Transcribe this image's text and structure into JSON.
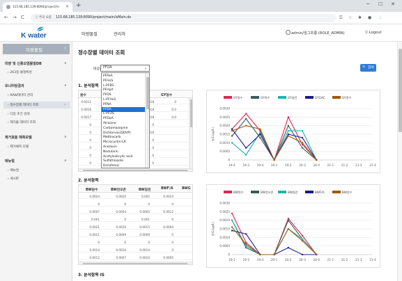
{
  "browser": {
    "tab_title": "115.68.185.139:8090/project/m",
    "url_info": "주의 요함",
    "url": "115.68.185.139:8090/project/main/isMain.do"
  },
  "app": {
    "logo_text": "K water",
    "menu": [
      "미량물질",
      "관리자"
    ],
    "user": "admin/임그조룡 (ROLE_ADMIN)",
    "logout": "Logout"
  },
  "sidebar": {
    "title": "미량물질",
    "groups": [
      {
        "label": "미량 및 신종오염물질DB",
        "items": [
          "263종 물질특성"
        ]
      },
      {
        "label": "모니터링결과",
        "items": [
          "RAW데이터 관리",
          "정수장별 데이터 조회",
          "다중 조건 검색",
          "제거율 데이터 조회"
        ]
      },
      {
        "label": "제거효율 예측모델",
        "items": [
          "제거예측 모델"
        ]
      },
      {
        "label": "매뉴얼",
        "items": [
          "매뉴얼",
          "게시판"
        ]
      }
    ]
  },
  "main": {
    "title": "정수장별 데이터 조회",
    "filter_label": "대상물질",
    "selected": "PFOA",
    "search_button": "검색",
    "section1": "1. 분석항목",
    "section2": "2. 분석항목",
    "section3": "3. 분석항목 IS"
  },
  "dropdown_options": [
    "PFPeA",
    "PFHxS",
    "L-PFBS",
    "PFHpA",
    "PFDS",
    "L-PFHxS",
    "PFNA",
    "PFDA",
    "L-PFOS",
    "PFDoA",
    "Atrazine",
    "Carbamazepine",
    "Dichlorvos(DDVP)",
    "Methiocarb",
    "Microcystin-LR",
    "Anatoxin",
    "Nodularin",
    "Acetylsalicylic acid",
    "Sulfathiazole",
    "Diclofenac"
  ],
  "dropdown_selected_index": 7,
  "table1": {
    "headers": [
      "원수",
      "",
      "",
      "GYGAC",
      "GY정수"
    ],
    "rows": [
      [
        "0.0011",
        "",
        "",
        "0.0018",
        "0"
      ],
      [
        "0.0016",
        "",
        "",
        "0.0018",
        "0.0"
      ],
      [
        "0.0017",
        "",
        "",
        "0.0018",
        "0.0"
      ],
      [
        "0",
        "",
        "",
        "0",
        ""
      ],
      [
        "0",
        "",
        "",
        "0.0016",
        ""
      ],
      [
        "0",
        "",
        "",
        "0",
        ""
      ],
      [
        "0",
        "",
        "",
        "0",
        ""
      ],
      [
        "0",
        "",
        "",
        "0",
        ""
      ],
      [
        "0",
        "",
        "",
        "0",
        ""
      ]
    ]
  },
  "table2": {
    "headers": [
      "BW원수",
      "BW전오존",
      "BW침전",
      "BWF/A",
      "BWG"
    ],
    "rows": [
      [
        "0.0024",
        "0.0020",
        "0.002",
        "0.0014",
        ""
      ],
      [
        "0",
        "0",
        "0",
        "0",
        ""
      ],
      [
        "0.0007",
        "0.0004",
        "0.0005",
        "0.0012",
        ""
      ],
      [
        "0.001",
        "0",
        "0.001",
        "0",
        ""
      ],
      [
        "0.0021",
        "0.0020",
        "0.0015",
        "0.0004",
        ""
      ],
      [
        "0.0011",
        "0.0009",
        "0.0009",
        "0",
        ""
      ],
      [
        "0",
        "0",
        "0",
        "0",
        ""
      ],
      [
        "0.0014",
        "0.0016",
        "0.0014",
        "0",
        ""
      ],
      [
        "0.0012",
        "0.0007",
        "0.0010",
        "0.0005",
        ""
      ]
    ]
  },
  "chart_data": [
    {
      "type": "line",
      "ylabel": "농도(μg/L)",
      "x": [
        "19-2",
        "19-3",
        "19-4",
        "20-1",
        "20-2",
        "20-3",
        "20-4",
        "21-1",
        "21-2",
        "21-3",
        "21-4"
      ],
      "ylim": [
        0,
        0.003
      ],
      "yticks": [
        "0.0030",
        "0.0025",
        "0.0020",
        "0.0015",
        "0.0010",
        "0.0005",
        "0"
      ],
      "series": [
        {
          "name": "GY원수",
          "color": "#e3264e",
          "values": [
            0.0018,
            0.0027,
            0.0017,
            0,
            0.0025,
            0.0009,
            0
          ]
        },
        {
          "name": "GY착수",
          "color": "#3f5a5a",
          "values": [
            0.0014,
            0.0024,
            0.0013,
            0,
            0.002,
            0.0007,
            0
          ]
        },
        {
          "name": "GY침전",
          "color": "#1cb5ad",
          "values": [
            0.001,
            0.0003,
            0.0016,
            0,
            0.0017,
            0.0017,
            0
          ]
        },
        {
          "name": "GYGAC",
          "color": "#1c1c8c",
          "values": [
            0.0018,
            0.0007,
            0.0015,
            0,
            0.0015,
            0.0013,
            0
          ]
        },
        {
          "name": "GY정수",
          "color": "#a05a10",
          "values": [
            0.0017,
            0.002,
            0.0018,
            0,
            0.0014,
            0.001,
            0
          ]
        }
      ]
    },
    {
      "type": "line",
      "ylabel": "농도(μg/L)",
      "x": [
        "19-2",
        "19-3",
        "19-4",
        "20-1",
        "20-2",
        "20-3",
        "20-4",
        "21-1",
        "21-2",
        "21-3",
        "21-4"
      ],
      "ylim": [
        0,
        0.003
      ],
      "yticks": [
        "0.0030",
        "0.0025",
        "0.0020",
        "0.0015",
        "0.0010",
        "0.0005",
        "0"
      ],
      "series": [
        {
          "name": "BW원수",
          "color": "#e3264e",
          "values": [
            0.0024,
            0.0007,
            0,
            0,
            0.0021,
            0.0011,
            0
          ]
        },
        {
          "name": "BW전오존",
          "color": "#3f5a5a",
          "values": [
            0.002,
            0.0004,
            0,
            0,
            0.002,
            0.0009,
            0
          ]
        },
        {
          "name": "BW침전",
          "color": "#1cb5ad",
          "values": [
            0.002,
            0.0005,
            0,
            0,
            0.0015,
            0.0009,
            0
          ]
        },
        {
          "name": "BWF/A",
          "color": "#1c1c8c",
          "values": [
            0.0014,
            0.0012,
            0,
            0,
            0.0004,
            0,
            0
          ]
        },
        {
          "name": "BW정수",
          "color": "#a05a10",
          "values": [
            0.0016,
            0.0006,
            0,
            0,
            0.0015,
            0.0008,
            0
          ]
        }
      ]
    }
  ]
}
